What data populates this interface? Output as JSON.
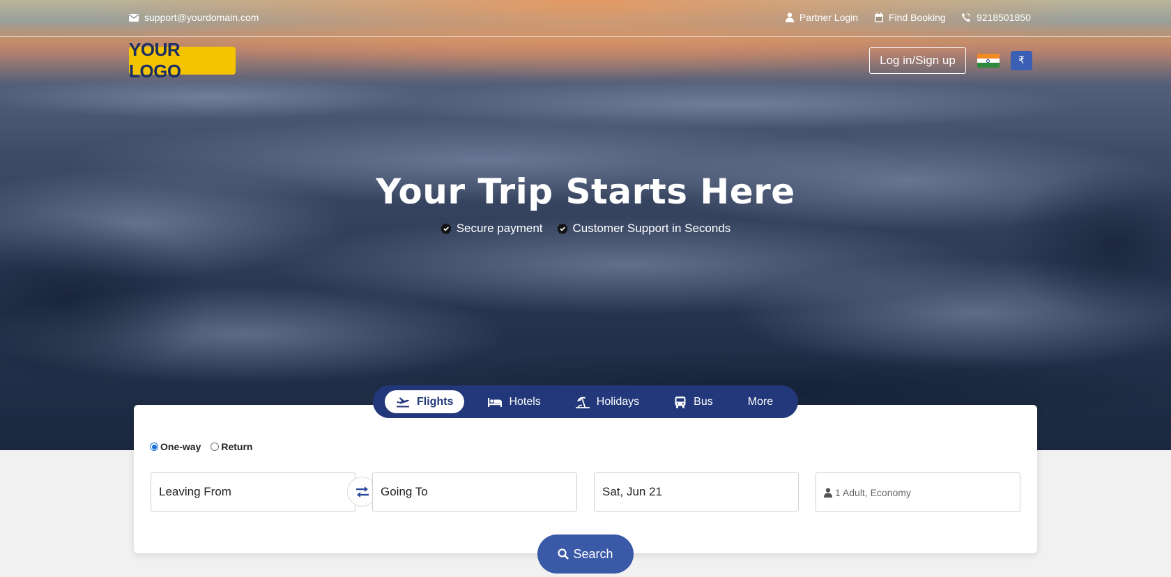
{
  "topbar": {
    "email": "support@yourdomain.com",
    "partner_login": "Partner Login",
    "find_booking": "Find Booking",
    "phone": "9218501850"
  },
  "header": {
    "logo_text": "YOUR LOGO",
    "login_label": "Log in/Sign up",
    "currency_symbol": "₹",
    "country": "India"
  },
  "hero": {
    "title": "Your Trip Starts Here",
    "features": [
      "Secure payment",
      "Customer Support in Seconds"
    ]
  },
  "tabs": [
    {
      "label": "Flights",
      "icon": "plane-icon",
      "active": true
    },
    {
      "label": "Hotels",
      "icon": "bed-icon",
      "active": false
    },
    {
      "label": "Holidays",
      "icon": "beach-icon",
      "active": false
    },
    {
      "label": "Bus",
      "icon": "bus-icon",
      "active": false
    },
    {
      "label": "More",
      "icon": "",
      "active": false
    }
  ],
  "search": {
    "trip_types": [
      {
        "label": "One-way",
        "checked": true
      },
      {
        "label": "Return",
        "checked": false
      }
    ],
    "from_placeholder": "Leaving From",
    "to_placeholder": "Going To",
    "date": "Sat, Jun 21",
    "travellers": "1 Adult, Economy",
    "search_label": "Search"
  },
  "colors": {
    "brand_navy": "#22387a",
    "search_blue": "#3a5aa8",
    "logo_yellow": "#f5c400"
  }
}
